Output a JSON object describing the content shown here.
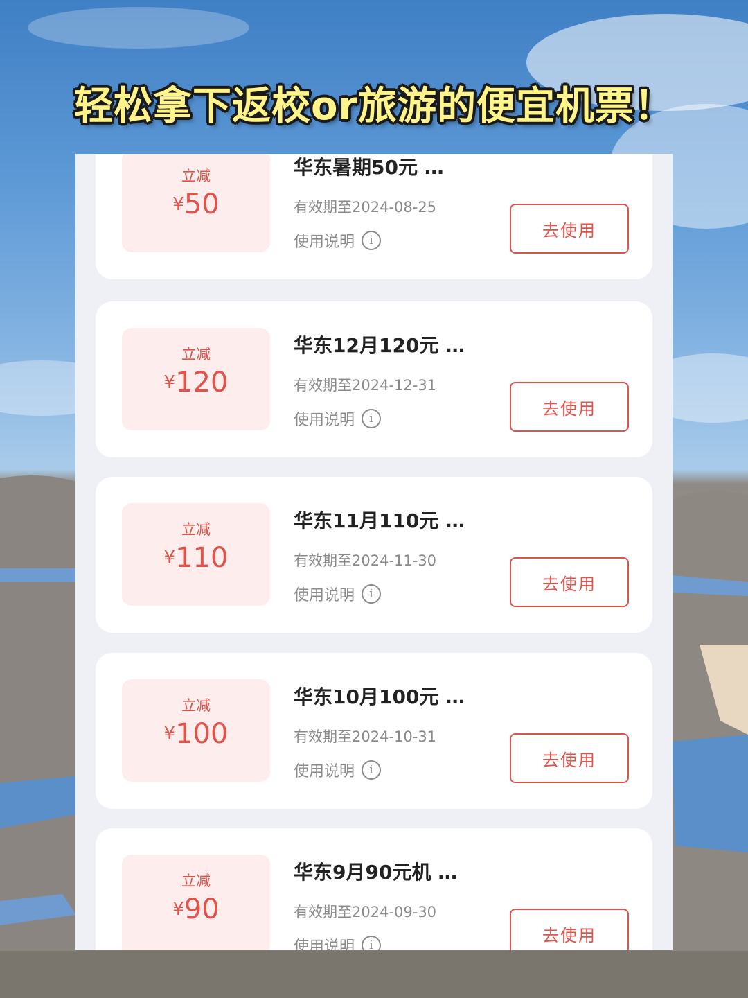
{
  "headline": "轻松拿下返校or旅游的便宜机票！",
  "coupons": [
    {
      "discount_label": "立减",
      "currency": "¥",
      "amount": "50",
      "title": "华东暑期50元 …",
      "validity": "有效期至2024-08-25",
      "rules_label": "使用说明",
      "button_label": "去使用"
    },
    {
      "discount_label": "立减",
      "currency": "¥",
      "amount": "120",
      "title": "华东12月120元 …",
      "validity": "有效期至2024-12-31",
      "rules_label": "使用说明",
      "button_label": "去使用"
    },
    {
      "discount_label": "立减",
      "currency": "¥",
      "amount": "110",
      "title": "华东11月110元 …",
      "validity": "有效期至2024-11-30",
      "rules_label": "使用说明",
      "button_label": "去使用"
    },
    {
      "discount_label": "立减",
      "currency": "¥",
      "amount": "100",
      "title": "华东10月100元 …",
      "validity": "有效期至2024-10-31",
      "rules_label": "使用说明",
      "button_label": "去使用"
    },
    {
      "discount_label": "立减",
      "currency": "¥",
      "amount": "90",
      "title": "华东9月90元机 …",
      "validity": "有效期至2024-09-30",
      "rules_label": "使用说明",
      "button_label": "去使用"
    }
  ],
  "icons": {
    "info": "info-circle-icon"
  },
  "colors": {
    "accent": "#e0524a",
    "headline_fill": "#fff48a",
    "discount_bg": "#fdeeed"
  }
}
